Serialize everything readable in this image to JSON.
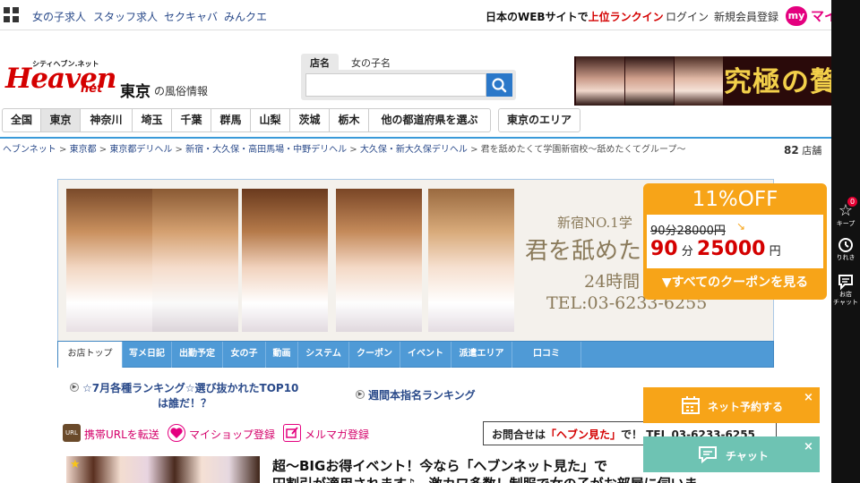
{
  "topbar": {
    "links": [
      "女の子求人",
      "スタッフ求人",
      "セクキャバ",
      "みんクエ"
    ],
    "ranking_prefix": "日本のWEBサイトで",
    "ranking_highlight": "上位ランクイン",
    "login": "ログイン",
    "register": "新規会員登録",
    "my_badge": "my",
    "my_text": "マイ"
  },
  "logo": {
    "top": "シティヘブン.ネット",
    "main": "Heaven",
    "net": "net",
    "region": "東京",
    "region_suffix": "の風俗情報"
  },
  "search": {
    "tab_shop": "店名",
    "tab_girl": "女の子名",
    "placeholder": ""
  },
  "banner": {
    "text": "究極の贅"
  },
  "prefectures": {
    "items": [
      "全国",
      "東京",
      "神奈川",
      "埼玉",
      "千葉",
      "群馬",
      "山梨",
      "茨城",
      "栃木",
      "他の都道府県を選ぶ"
    ],
    "active_index": 1,
    "area_button": "東京のエリア"
  },
  "breadcrumb": {
    "items": [
      "ヘブンネット",
      "東京都",
      "東京都デリヘル",
      "新宿・大久保・高田馬場・中野デリヘル",
      "大久保・新大久保デリヘル",
      "君を舐めたくて学園新宿校～舐めたくてグループ～"
    ],
    "separator": ">"
  },
  "shop_count": {
    "number": "82",
    "unit": "店舗"
  },
  "hero": {
    "tag1": "新宿NO.1学",
    "tag2": "君を舐めた",
    "tag3": "24時間",
    "tag4": "TEL:03-6233-6255"
  },
  "shop_tabs": [
    "お店トップ",
    "写メ日記",
    "出勤予定",
    "女の子",
    "動画",
    "システム",
    "クーポン",
    "イベント",
    "派遣エリア",
    "口コミ"
  ],
  "rankings": {
    "left_line1": "☆7月各種ランキング☆選び抜かれたTOP10",
    "left_line2": "は誰だ！？",
    "right": "週間本指名ランキング"
  },
  "links": {
    "url": "携帯URLを転送",
    "myshop": "マイショップ登録",
    "mailmag": "メルマガ登録",
    "url_icon": "URL"
  },
  "contact": {
    "prefix": "お問合せは",
    "quote": "「ヘブン見た」",
    "suffix": "で！",
    "tel": "TEL 03-6233-6255"
  },
  "article": {
    "line1": "超～BIGお得イベント！今なら「ヘブンネット見た」で",
    "line2": "円割引が適用されます♪　激カワ多数！制服で女の子がお部屋に伺いま"
  },
  "coupon": {
    "title": "11%OFF",
    "old_price": "90分28000円",
    "new_minutes": "90",
    "minutes_unit": "分",
    "new_price": "25000",
    "price_unit": "円",
    "link": "▼すべてのクーポンを見る"
  },
  "floating": {
    "reserve": "ネット予約する",
    "chat": "チャット",
    "close": "×"
  },
  "sidebar": {
    "keep_label": "キープ",
    "keep_count": "0",
    "history_label": "りれき",
    "chat_label1": "お店",
    "chat_label2": "チャット"
  }
}
